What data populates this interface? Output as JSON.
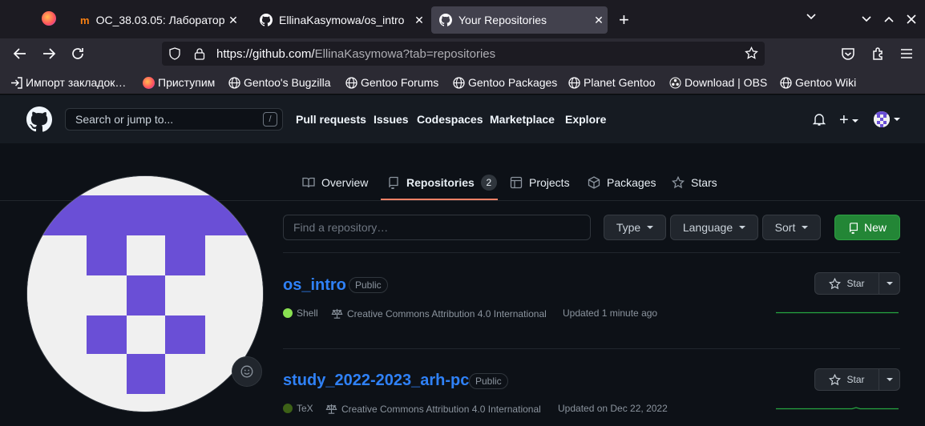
{
  "browser": {
    "tabs": [
      {
        "label": "ОС_38.03.05: Лаборатор",
        "close": "✕"
      },
      {
        "label": "EllinaKasymowa/os_intro",
        "close": "✕"
      },
      {
        "label": "Your Repositories",
        "close": "✕"
      }
    ],
    "new_tab": "+",
    "url_prefix": "https://github.com/",
    "url_rest": "EllinaKasymowa?tab=repositories",
    "bookmarks": [
      {
        "label": "Импорт закладок…",
        "icon": "import-icon"
      },
      {
        "label": "Приступим",
        "icon": "firefox-icon"
      },
      {
        "label": "Gentoo's Bugzilla",
        "icon": "globe-icon"
      },
      {
        "label": "Gentoo Forums",
        "icon": "globe-icon"
      },
      {
        "label": "Gentoo Packages",
        "icon": "globe-icon"
      },
      {
        "label": "Planet Gentoo",
        "icon": "globe-icon"
      },
      {
        "label": "Download | OBS",
        "icon": "obs-icon"
      },
      {
        "label": "Gentoo Wiki",
        "icon": "globe-icon"
      }
    ]
  },
  "header": {
    "search_placeholder": "Search or jump to...",
    "slash": "/",
    "nav": [
      "Pull requests",
      "Issues",
      "Codespaces",
      "Marketplace",
      "Explore"
    ],
    "plus": "+"
  },
  "profile_tabs": [
    {
      "label": "Overview"
    },
    {
      "label": "Repositories",
      "count": "2"
    },
    {
      "label": "Projects"
    },
    {
      "label": "Packages"
    },
    {
      "label": "Stars"
    }
  ],
  "filters": {
    "find_placeholder": "Find a repository…",
    "type": "Type",
    "language": "Language",
    "sort": "Sort",
    "new": "New"
  },
  "repos": [
    {
      "name": "os_intro",
      "visibility": "Public",
      "language": "Shell",
      "lang_color": "#89e051",
      "license": "Creative Commons Attribution 4.0 International",
      "updated": "Updated 1 minute ago",
      "star": "Star"
    },
    {
      "name": "study_2022-2023_arh-pc",
      "visibility": "Public",
      "language": "TeX",
      "lang_color": "#3d6117",
      "license": "Creative Commons Attribution 4.0 International",
      "updated": "Updated on Dec 22, 2022",
      "star": "Star"
    }
  ],
  "colors": {
    "accent": "#2f81f7",
    "new_button": "#238636",
    "avatar_purple": "#6a4fd6",
    "tab_underline": "#f78166"
  }
}
